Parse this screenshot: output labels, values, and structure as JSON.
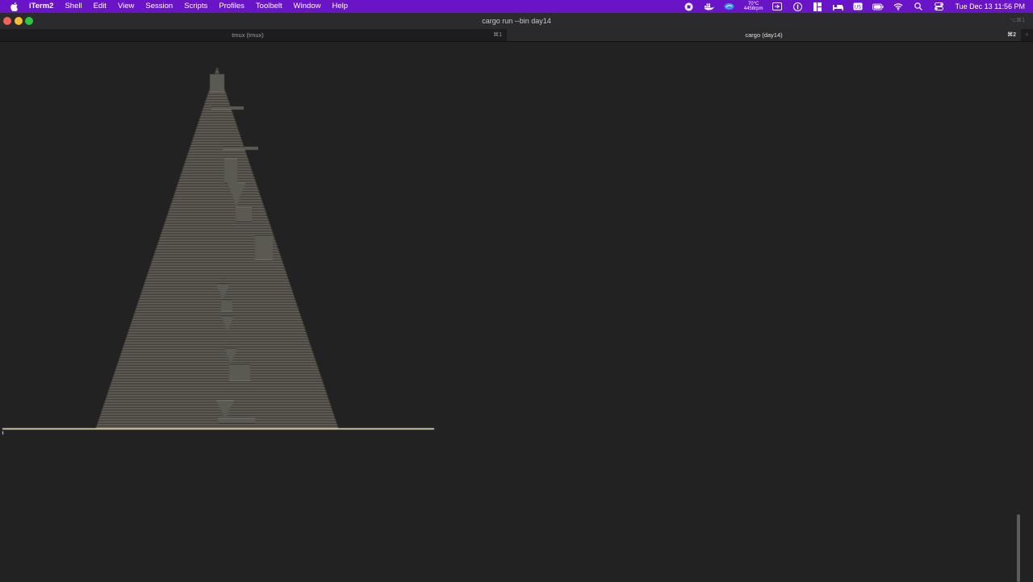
{
  "menubar": {
    "app_name": "iTerm2",
    "items": [
      "Shell",
      "Edit",
      "View",
      "Session",
      "Scripts",
      "Profiles",
      "Toolbelt",
      "Window",
      "Help"
    ],
    "status": {
      "temp": "70°C",
      "rpm": "4458rpm",
      "clock": "Tue Dec 13  11:56 PM"
    }
  },
  "window": {
    "title": "cargo run --bin day14",
    "shortcut": "⌥⌘1"
  },
  "tabs": [
    {
      "label": "tmux (tmux)",
      "shortcut": "⌘1",
      "active": false
    },
    {
      "label": "cargo (day14)",
      "shortcut": "⌘2",
      "active": true
    }
  ],
  "new_tab_label": "+",
  "terminal": {
    "background": "#222222",
    "sand_color": "#a89f88",
    "rock_color": "#5b5a52",
    "floor_color": "#c8bfa0"
  }
}
